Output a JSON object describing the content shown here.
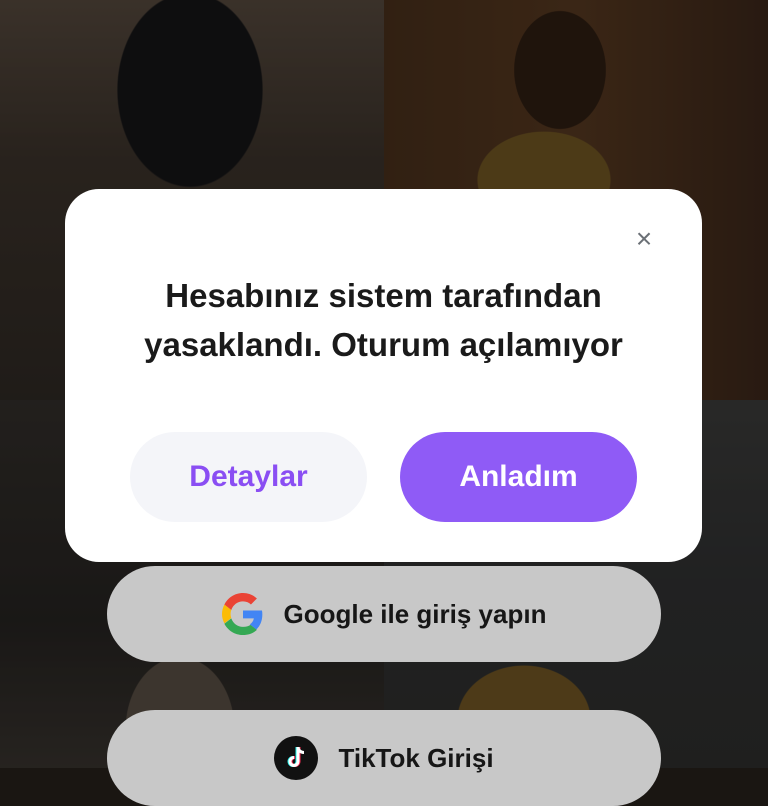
{
  "modal": {
    "message_line1": "Hesabınız sistem tarafından",
    "message_line2": "yasaklandı. Oturum açılamıyor",
    "close_glyph": "×",
    "details_label": "Detaylar",
    "ok_label": "Anladım"
  },
  "login": {
    "google_label": "Google ile giriş yapın",
    "tiktok_label": "TikTok Girişi"
  },
  "colors": {
    "accent": "#8f5bf6",
    "accent_text": "#8a4ef3",
    "secondary_button_bg": "#f4f5f9",
    "login_button_bg": "#c8c8c8"
  },
  "icons": [
    "close-icon",
    "google-icon",
    "tiktok-icon"
  ]
}
